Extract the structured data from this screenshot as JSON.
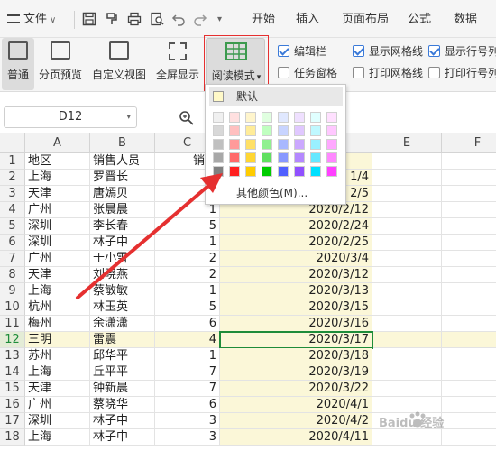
{
  "menubar": {
    "file_label": "文件",
    "tabs": [
      "开始",
      "插入",
      "页面布局",
      "公式",
      "数据"
    ]
  },
  "ribbon": {
    "buttons": [
      "普通",
      "分页预览",
      "自定义视图",
      "全屏显示",
      "阅读模式"
    ],
    "checkboxes": [
      {
        "label": "编辑栏",
        "checked": true
      },
      {
        "label": "显示网格线",
        "checked": true
      },
      {
        "label": "显示行号列",
        "checked": true
      },
      {
        "label": "任务窗格",
        "checked": false
      },
      {
        "label": "打印网格线",
        "checked": false
      },
      {
        "label": "打印行号列",
        "checked": false
      }
    ]
  },
  "formula_bar": {
    "name_box": "D12"
  },
  "dropdown": {
    "default_label": "默认",
    "more_colors_label": "其他颜色(M)...",
    "selected_color": "#e53030",
    "palette_columns": [
      [
        "#f0f0f0",
        "#d8d8d8",
        "#c0c0c0",
        "#a8a8a8",
        "#808080"
      ],
      [
        "#ffe0e0",
        "#ffc0c0",
        "#ff9a9a",
        "#ff6a6a",
        "#ff2020"
      ],
      [
        "#fff5cc",
        "#ffec99",
        "#ffe066",
        "#ffd633",
        "#ffcc00"
      ],
      [
        "#e0ffe0",
        "#c0ffc0",
        "#90f090",
        "#60e060",
        "#00cc00"
      ],
      [
        "#e0e8ff",
        "#c8d4ff",
        "#a8b8ff",
        "#8898ff",
        "#5060ff"
      ],
      [
        "#efe0ff",
        "#e0c8ff",
        "#cba8ff",
        "#b488ff",
        "#9050ff"
      ],
      [
        "#e0ffff",
        "#bff8ff",
        "#99f0ff",
        "#66e8ff",
        "#00e0ff"
      ],
      [
        "#ffe0ff",
        "#ffc8ff",
        "#ffa8ff",
        "#ff88ff",
        "#ff40ff"
      ]
    ]
  },
  "sheet": {
    "columns": [
      "A",
      "B",
      "C",
      "D",
      "E",
      "F"
    ],
    "rows": [
      {
        "n": "1",
        "a": "地区",
        "b": "销售人员",
        "c": "销量",
        "d": ""
      },
      {
        "n": "2",
        "a": "上海",
        "b": "罗晋长",
        "c": "",
        "d": "1/4"
      },
      {
        "n": "3",
        "a": "天津",
        "b": "唐嫣贝",
        "c": "",
        "d": "2/5"
      },
      {
        "n": "4",
        "a": "广州",
        "b": "张晨晨",
        "c": "1",
        "d": "2020/2/12"
      },
      {
        "n": "5",
        "a": "深圳",
        "b": "李长春",
        "c": "5",
        "d": "2020/2/24"
      },
      {
        "n": "6",
        "a": "深圳",
        "b": "林子中",
        "c": "1",
        "d": "2020/2/25"
      },
      {
        "n": "7",
        "a": "广州",
        "b": "于小雪",
        "c": "2",
        "d": "2020/3/4"
      },
      {
        "n": "8",
        "a": "天津",
        "b": "刘晓燕",
        "c": "2",
        "d": "2020/3/12"
      },
      {
        "n": "9",
        "a": "上海",
        "b": "蔡敏敏",
        "c": "1",
        "d": "2020/3/13"
      },
      {
        "n": "10",
        "a": "杭州",
        "b": "林玉英",
        "c": "5",
        "d": "2020/3/15"
      },
      {
        "n": "11",
        "a": "梅州",
        "b": "余潇潇",
        "c": "6",
        "d": "2020/3/16"
      },
      {
        "n": "12",
        "a": "三明",
        "b": "雷震",
        "c": "4",
        "d": "2020/3/17"
      },
      {
        "n": "13",
        "a": "苏州",
        "b": "邱华平",
        "c": "1",
        "d": "2020/3/18"
      },
      {
        "n": "14",
        "a": "上海",
        "b": "丘平平",
        "c": "7",
        "d": "2020/3/19"
      },
      {
        "n": "15",
        "a": "天津",
        "b": "钟新晨",
        "c": "7",
        "d": "2020/3/22"
      },
      {
        "n": "16",
        "a": "广州",
        "b": "蔡晓华",
        "c": "6",
        "d": "2020/4/1"
      },
      {
        "n": "17",
        "a": "深圳",
        "b": "林子中",
        "c": "3",
        "d": "2020/4/2"
      },
      {
        "n": "18",
        "a": "上海",
        "b": "林子中",
        "c": "3",
        "d": "2020/4/11"
      }
    ],
    "active_row": "12"
  },
  "watermark": "Baidu 经验",
  "colors": {
    "accent_green": "#1e8c3a",
    "highlight_yellow": "#fbf7d8",
    "annotation_red": "#e53030"
  }
}
